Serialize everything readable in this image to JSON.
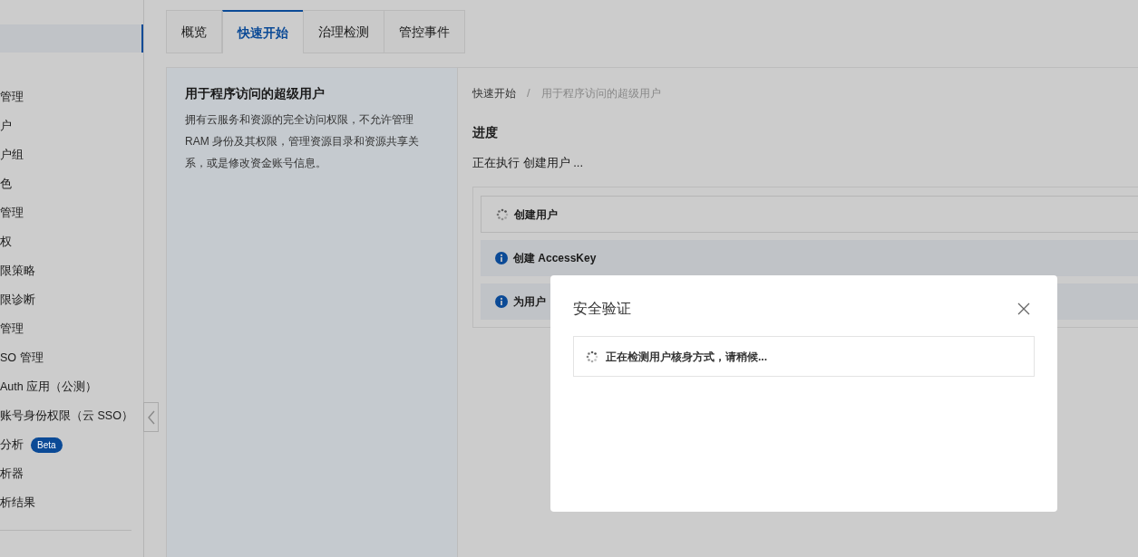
{
  "sidebar": {
    "items": [
      {
        "label": "管理"
      },
      {
        "label": "户"
      },
      {
        "label": "户组"
      },
      {
        "label": "色"
      },
      {
        "label": "管理"
      },
      {
        "label": "权"
      },
      {
        "label": "限策略"
      },
      {
        "label": "限诊断"
      },
      {
        "label": "管理"
      },
      {
        "label": "SO 管理"
      },
      {
        "label": "Auth 应用（公测）"
      },
      {
        "label": "账号身份权限（云 SSO）"
      },
      {
        "label": "分析",
        "badge": "Beta"
      },
      {
        "label": "析器"
      },
      {
        "label": "析结果"
      }
    ]
  },
  "tabs": [
    {
      "label": "概览",
      "selected": false
    },
    {
      "label": "快速开始",
      "selected": true
    },
    {
      "label": "治理检测",
      "selected": false
    },
    {
      "label": "管控事件",
      "selected": false
    }
  ],
  "template": {
    "title": "用于程序访问的超级用户",
    "description": "拥有云服务和资源的完全访问权限，不允许管理 RAM 身份及其权限，管理资源目录和资源共享关系，或是修改资金账号信息。"
  },
  "breadcrumb": [
    "快速开始",
    "用于程序访问的超级用户"
  ],
  "breadcrumb_separator": "/",
  "progress": {
    "heading": "进度",
    "status": "正在执行 创建用户 ...",
    "steps": [
      {
        "kind": "loading",
        "label": "创建用户"
      },
      {
        "kind": "info",
        "label": "创建 AccessKey"
      },
      {
        "kind": "info",
        "label": "为用户"
      }
    ]
  },
  "dialog": {
    "title": "安全验证",
    "message": "正在检测用户核身方式，请稍候..."
  }
}
